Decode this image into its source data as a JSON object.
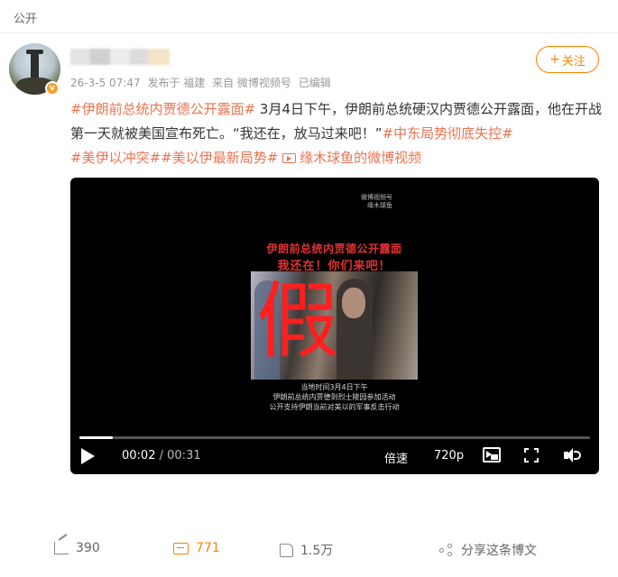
{
  "header": {
    "visibility": "公开"
  },
  "author": {
    "timestamp": "26-3-5 07:47",
    "published_from": "发布于 福建",
    "source": "来自 微博视频号",
    "edited": "已编辑"
  },
  "follow_button": {
    "label": "关注",
    "icon": "plus-icon"
  },
  "post": {
    "tag1": "#伊朗前总统内贾德公开露面#",
    "body": " 3月4日下午，伊朗前总统硬汉内贾德公开露面，他在开战第一天就被美国宣布死亡。“我还在，放马过来吧！”",
    "tag2": "#中东局势彻底失控#",
    "tag3": "#美伊以冲突#",
    "tag4": "#美以伊最新局势#",
    "video_link": "缘木球鱼的微博视频"
  },
  "video": {
    "watermark_line1": "微博视频号",
    "watermark_line2": "缘木球鱼",
    "headline1": "伊朗前总统内贾德公开露面",
    "headline2": "我还在！你们来吧！",
    "overlay": "假",
    "caption1": "当地时间3月4日下午",
    "caption2": "伊朗前总统内贾德到烈士陵园参加活动",
    "caption3": "公开支持伊朗当前对美以的军事反击行动",
    "current_time": "00:02",
    "separator": "/",
    "duration": "00:31",
    "progress": 0.065,
    "speed_label": "倍速",
    "quality_label": "720p"
  },
  "actions": {
    "share_count": "390",
    "comment_count": "771",
    "like_count": "1.5万",
    "retweet_label": "分享这条博文"
  },
  "colors": {
    "accent": "#ff8200",
    "tag": "#eb7350"
  }
}
